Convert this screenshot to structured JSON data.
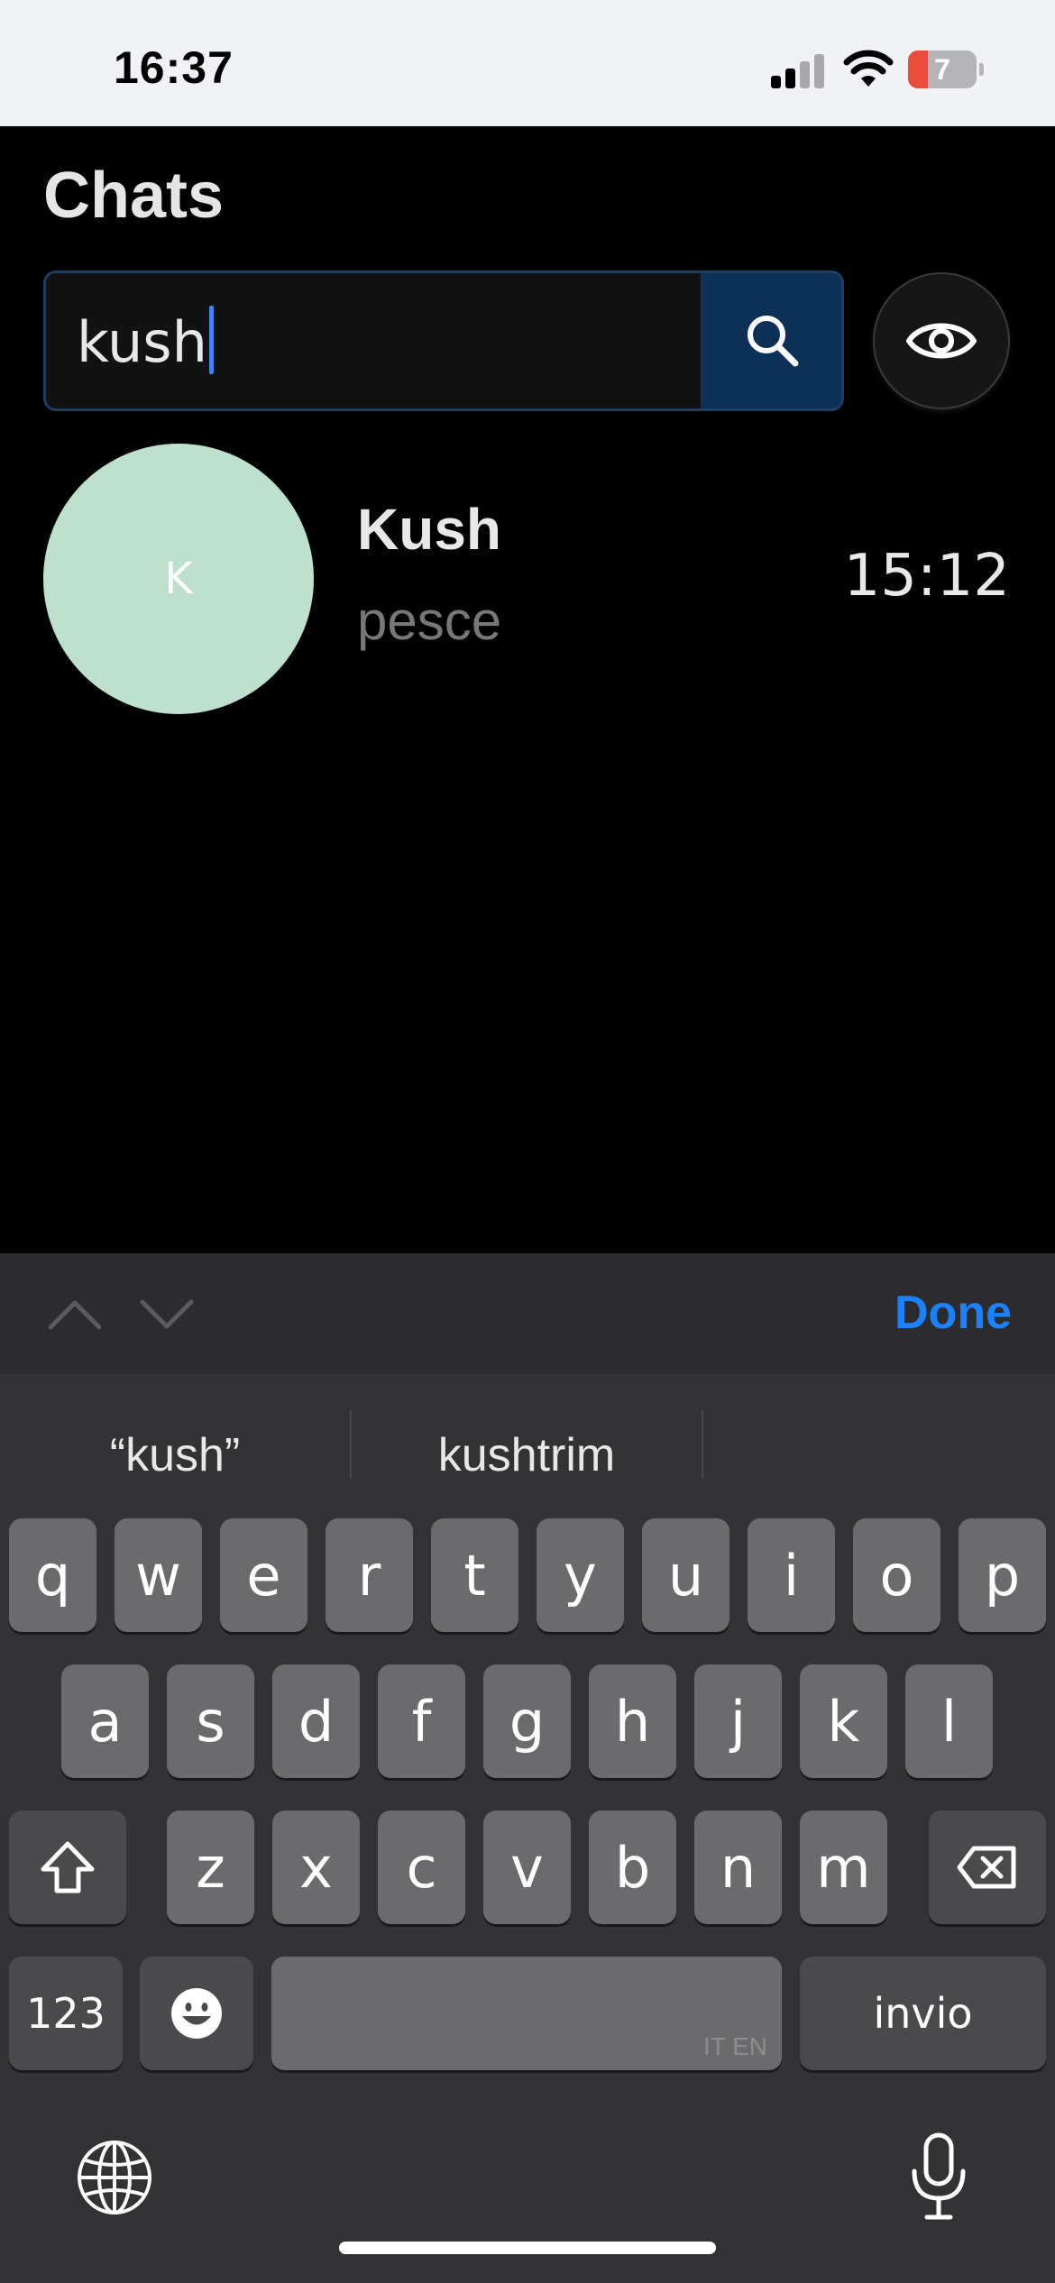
{
  "status_bar": {
    "time": "16:37",
    "battery_level": "7",
    "icons": [
      "signal-icon",
      "wifi-icon",
      "battery-icon"
    ]
  },
  "header": {
    "title": "Chats"
  },
  "search": {
    "value": "kush",
    "icon": "search-icon"
  },
  "visibility_toggle": {
    "icon": "eye-icon"
  },
  "chats": [
    {
      "avatar_initial": "K",
      "avatar_color": "#bde1cc",
      "name": "Kush",
      "preview": "pesce",
      "time": "15:12"
    }
  ],
  "keyboard": {
    "accessory": {
      "done_label": "Done",
      "icons": [
        "chevron-up-icon",
        "chevron-down-icon"
      ]
    },
    "suggestions": [
      "“kush”",
      "kushtrim",
      ""
    ],
    "row1": [
      "q",
      "w",
      "e",
      "r",
      "t",
      "y",
      "u",
      "i",
      "o",
      "p"
    ],
    "row2": [
      "a",
      "s",
      "d",
      "f",
      "g",
      "h",
      "j",
      "k",
      "l"
    ],
    "row3": [
      "z",
      "x",
      "c",
      "v",
      "b",
      "n",
      "m"
    ],
    "numbers_label": "123",
    "space_languages": "IT EN",
    "return_label": "invio",
    "icons": [
      "shift-icon",
      "delete-icon",
      "emoji-icon",
      "globe-icon",
      "microphone-icon"
    ]
  },
  "colors": {
    "accent": "#1a82ff",
    "search_button": "#0d3057",
    "background": "#000000"
  }
}
